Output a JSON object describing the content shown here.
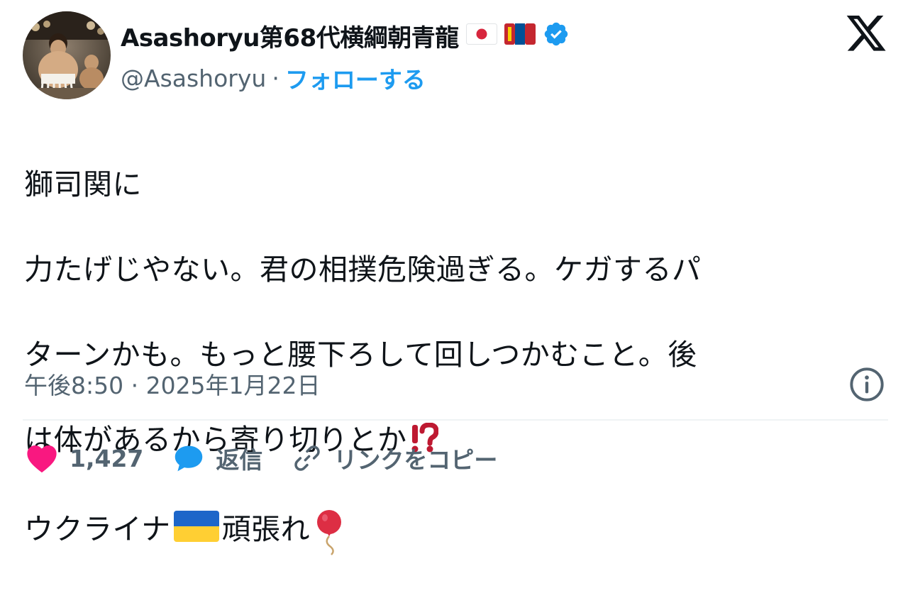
{
  "tweet": {
    "author": {
      "display_name": "Asashoryu第68代横綱朝青龍",
      "handle": "@Asashoryu",
      "separator": "·",
      "follow_label": "フォローする",
      "flags": [
        "japan-flag-icon",
        "mongolia-flag-icon"
      ],
      "verified_icon": "verified-badge-icon",
      "verified_color": "#1d9bf0"
    },
    "text_lines": [
      "獅司関に",
      "力たげじやない。君の相撲危険過ぎる。ケガするパ",
      "ターンかも。もっと腰下ろして回しつかむこと。後",
      "は体があるから寄り切りとか",
      "ウクライナ",
      "頑張れ"
    ],
    "emoji": {
      "interrobang": "⁉️",
      "ukraine_flag": "ukraine-flag-icon",
      "balloon": "balloon-icon"
    },
    "timestamp": "午後8:50 · 2025年1月22日",
    "actions": {
      "like_count": "1,427",
      "reply_label": "返信",
      "copy_link_label": "リンクをコピー"
    }
  },
  "colors": {
    "accent": "#1d9bf0",
    "text": "#0f1419",
    "secondary": "#536471",
    "like": "#f91880",
    "reply": "#1d9bf0"
  }
}
